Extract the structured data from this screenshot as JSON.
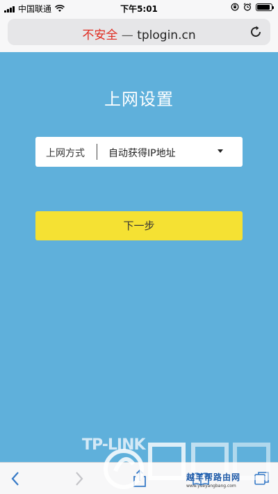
{
  "status_bar": {
    "carrier": "中国联通",
    "time": "下午5:01",
    "icons": [
      "signal-icon",
      "wifi-icon",
      "rotation-lock-icon",
      "alarm-icon",
      "battery-icon"
    ],
    "battery_level": 0.9
  },
  "browser": {
    "url_warning": "不安全",
    "url_separator": "—",
    "url_host": "tplogin.cn",
    "reload_icon": "reload-icon",
    "toolbar_icons": [
      "back-icon",
      "forward-icon",
      "share-icon",
      "bookmarks-icon",
      "tabs-icon"
    ]
  },
  "page": {
    "title": "上网设置",
    "connection_label": "上网方式",
    "connection_value": "自动获得IP地址",
    "next_button": "下一步",
    "brand": "TP-LINK"
  },
  "watermark": {
    "title": "越羊帮路由网",
    "url": "www.yueyangbang.com"
  },
  "colors": {
    "background": "#5fb0db",
    "button": "#f5e133",
    "url_warning": "#e02b20"
  }
}
